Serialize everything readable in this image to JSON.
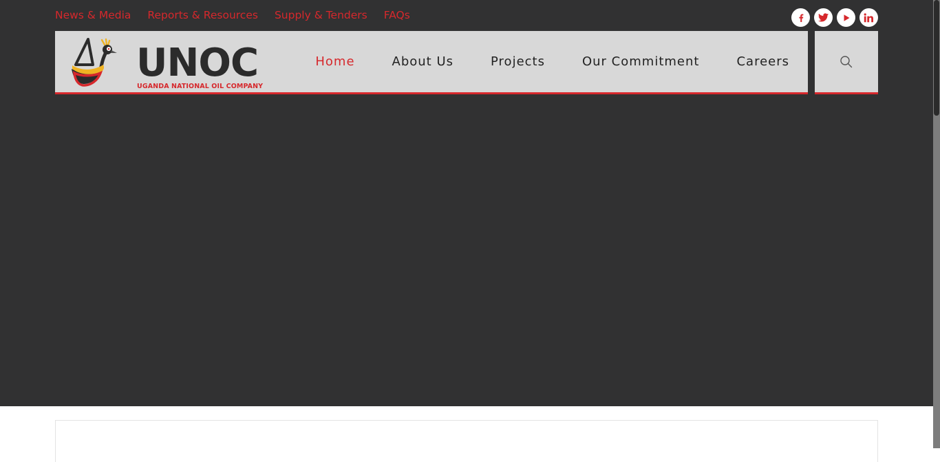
{
  "topnav": {
    "items": [
      {
        "label": "News & Media"
      },
      {
        "label": "Reports & Resources"
      },
      {
        "label": "Supply & Tenders"
      },
      {
        "label": "FAQs"
      }
    ]
  },
  "socials": [
    {
      "icon": "facebook-icon",
      "glyph": "f"
    },
    {
      "icon": "twitter-icon",
      "glyph": "🐦"
    },
    {
      "icon": "youtube-icon",
      "glyph": "▶"
    },
    {
      "icon": "linkedin-icon",
      "glyph": "in"
    }
  ],
  "logo": {
    "name": "UNOC",
    "tagline": "UGANDA NATIONAL OIL COMPANY"
  },
  "mainnav": {
    "items": [
      {
        "label": "Home",
        "active": true
      },
      {
        "label": "About Us"
      },
      {
        "label": "Projects"
      },
      {
        "label": "Our Commitment"
      },
      {
        "label": "Careers"
      }
    ]
  },
  "search": {
    "icon": "search-icon"
  },
  "colors": {
    "accent": "#d6282c",
    "hero_background": "#313132",
    "header_background": "#d8d8d8",
    "text_dark": "#222222"
  }
}
